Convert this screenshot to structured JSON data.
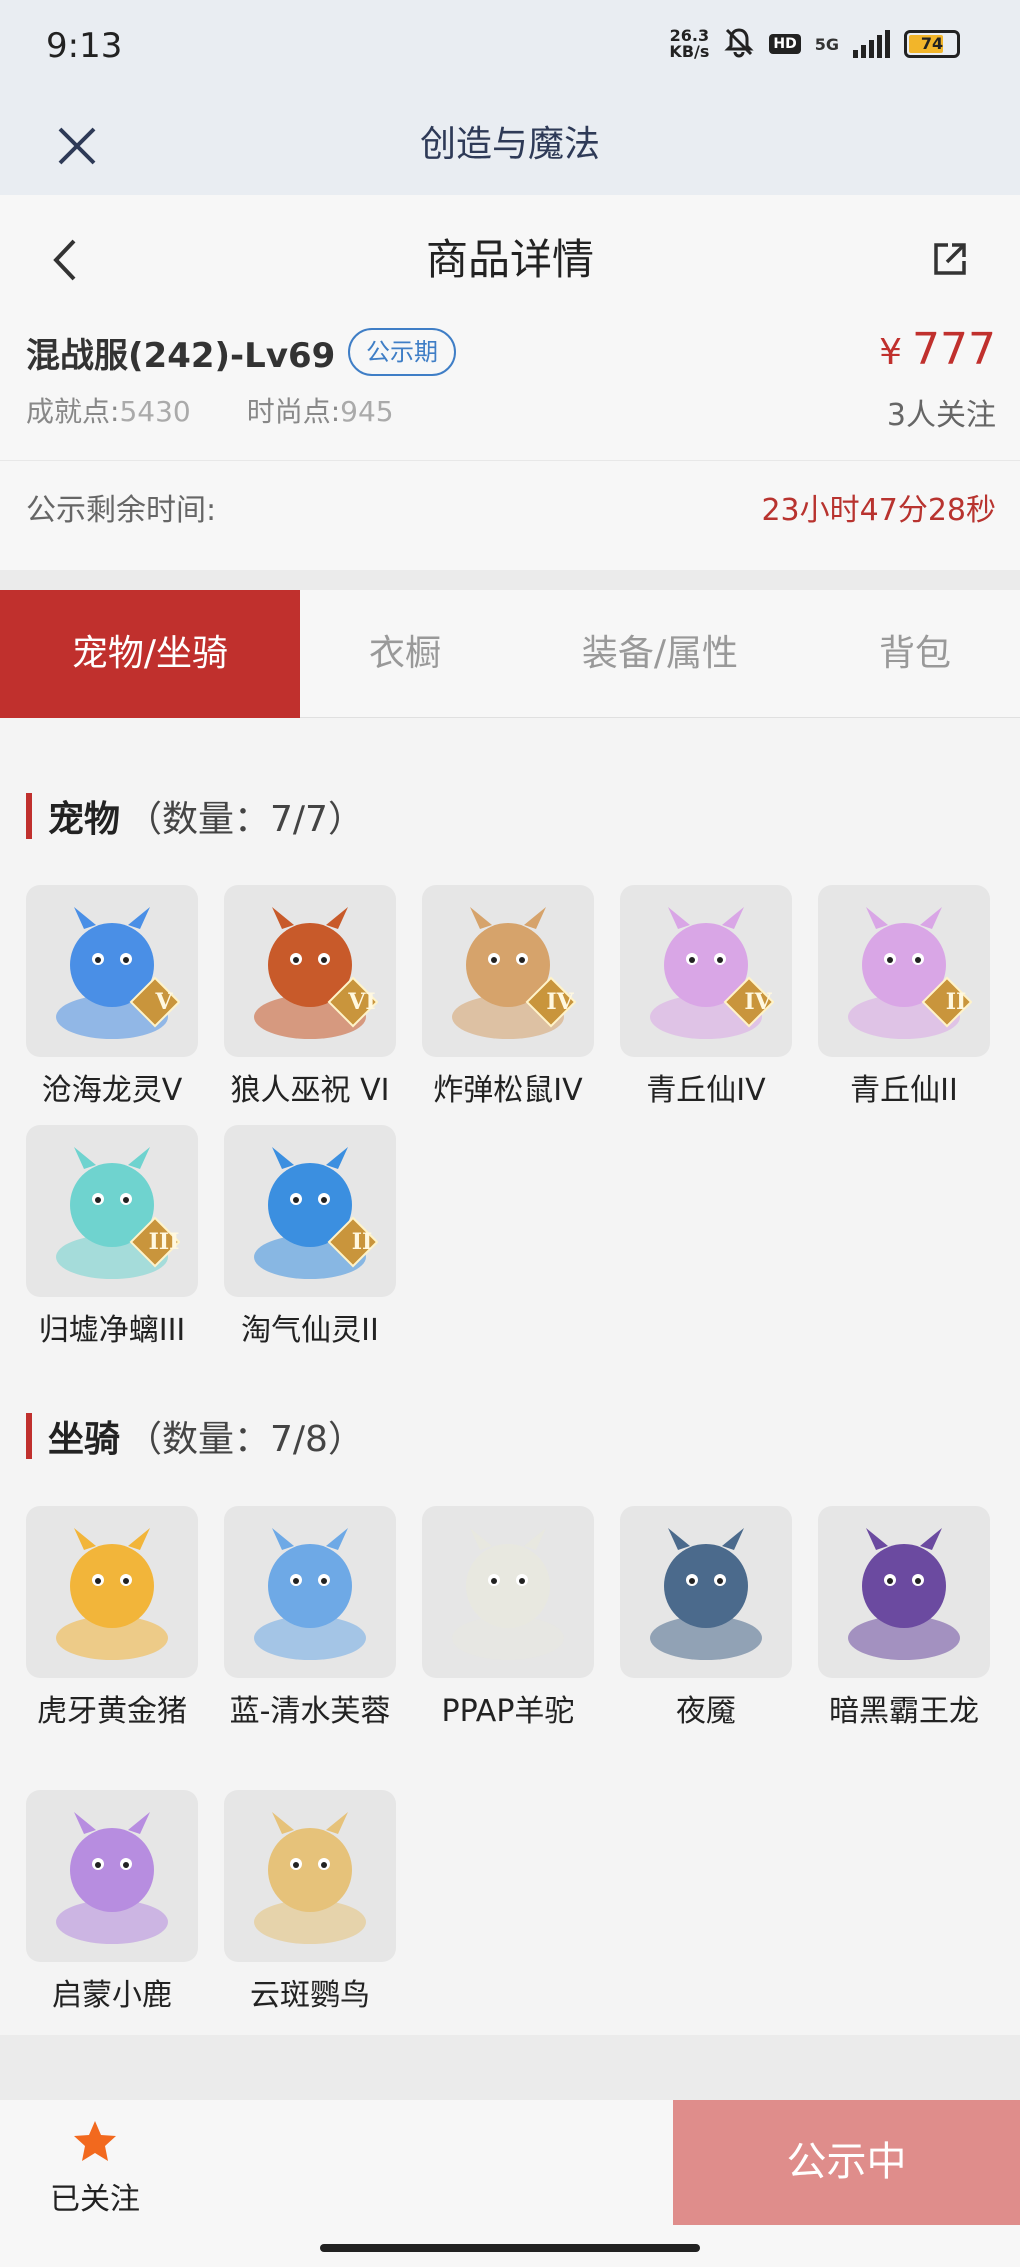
{
  "status_bar": {
    "time": "9:13",
    "net_speed_value": "26.3",
    "net_speed_unit": "KB/s",
    "network": "5G",
    "battery": "74"
  },
  "app_bar": {
    "title": "创造与魔法"
  },
  "header": {
    "title": "商品详情"
  },
  "listing": {
    "server": "混战服(242)-Lv69",
    "phase": "公示期",
    "achievement_label": "成就点:",
    "achievement_value": "5430",
    "fashion_label": "时尚点:",
    "fashion_value": "945",
    "currency": "¥",
    "price": "777",
    "watchers": "3人关注"
  },
  "countdown": {
    "label": "公示剩余时间:",
    "value": "23小时47分28秒"
  },
  "tabs": [
    {
      "label": "宠物/坐骑",
      "active": true
    },
    {
      "label": "衣橱"
    },
    {
      "label": "装备/属性"
    },
    {
      "label": "背包"
    }
  ],
  "pets": {
    "title": "宠物",
    "count": "（数量：7/7）",
    "items": [
      {
        "name": "沧海龙灵V",
        "rank": "V",
        "icon": "dragon-spirit-icon",
        "color": "#4a8fe6"
      },
      {
        "name": "狼人巫祝 VI",
        "rank": "VI",
        "icon": "werewolf-icon",
        "color": "#c85a2a"
      },
      {
        "name": "炸弹松鼠IV",
        "rank": "IV",
        "icon": "squirrel-icon",
        "color": "#d6a36b"
      },
      {
        "name": "青丘仙IV",
        "rank": "IV",
        "icon": "fox-fairy-icon",
        "color": "#d9a6e6"
      },
      {
        "name": "青丘仙II",
        "rank": "II",
        "icon": "fox-fairy-icon",
        "color": "#d9a6e6"
      },
      {
        "name": "归墟净螭III",
        "rank": "III",
        "icon": "jade-dragon-icon",
        "color": "#6fd3cf"
      },
      {
        "name": "淘气仙灵II",
        "rank": "II",
        "icon": "blue-pup-icon",
        "color": "#3b8fe0"
      }
    ]
  },
  "mounts": {
    "title": "坐骑",
    "count": "（数量：7/8）",
    "items": [
      {
        "name": "虎牙黄金猪",
        "icon": "golden-pig-icon",
        "color": "#f2b53a"
      },
      {
        "name": "蓝-清水芙蓉",
        "icon": "lotus-icon",
        "color": "#6ea9e6"
      },
      {
        "name": "PPAP羊驼",
        "icon": "alpaca-icon",
        "color": "#e8e8e0"
      },
      {
        "name": "夜魇",
        "icon": "nightmare-horse-icon",
        "color": "#4b6a8c"
      },
      {
        "name": "暗黑霸王龙",
        "icon": "dark-trex-icon",
        "color": "#6b4aa0"
      },
      {
        "name": "启蒙小鹿",
        "icon": "fawn-icon",
        "color": "#b78de0"
      },
      {
        "name": "云斑鹦鸟",
        "icon": "parrot-icon",
        "color": "#e6c27a"
      }
    ]
  },
  "bottom": {
    "follow_label": "已关注",
    "cta_label": "公示中",
    "star_color": "#f2691e"
  }
}
